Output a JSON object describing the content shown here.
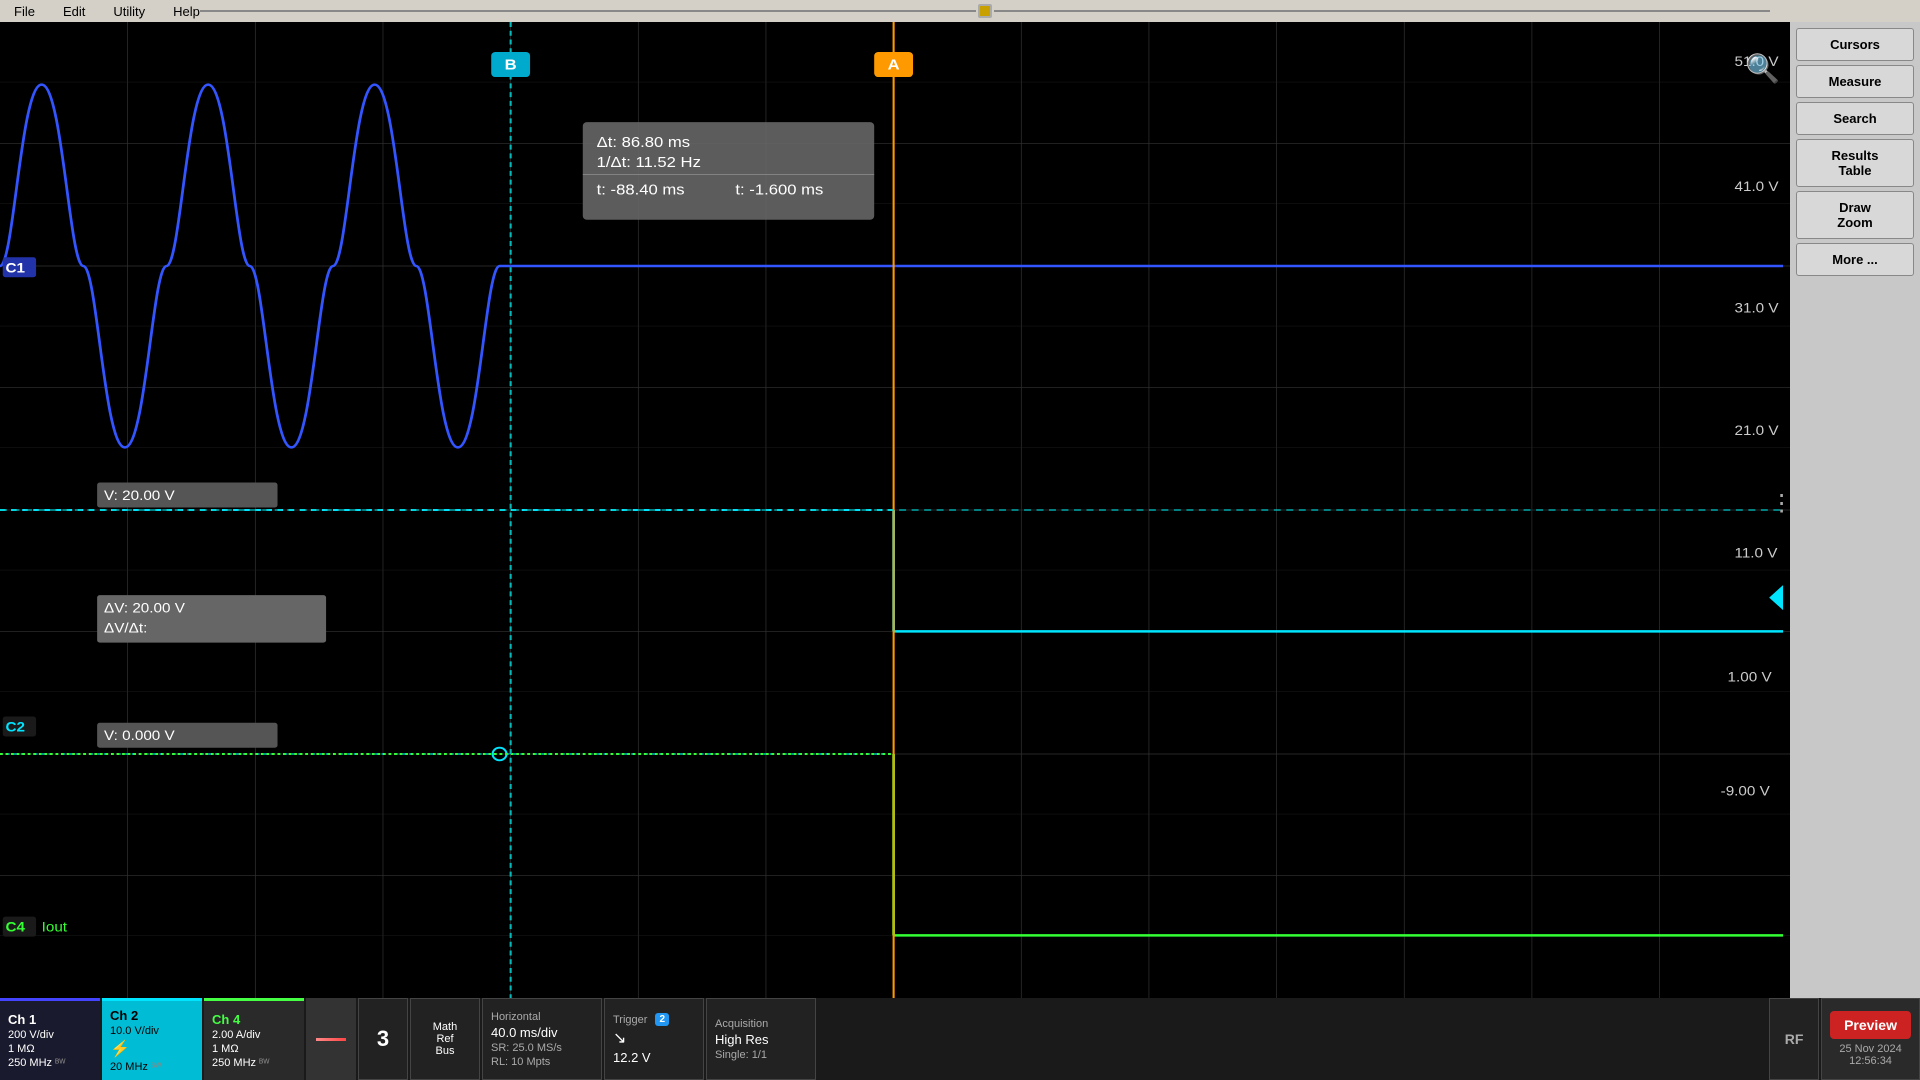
{
  "menubar": {
    "file": "File",
    "edit": "Edit",
    "utility": "Utility",
    "help": "Help"
  },
  "right_panel": {
    "cursors_label": "Cursors",
    "measure_label": "Measure",
    "search_label": "Search",
    "results_table_label": "Results\nTable",
    "draw_zoom_label": "Draw\nZoom",
    "more_label": "More ..."
  },
  "scope": {
    "v_labels": [
      {
        "value": "51.0 V",
        "pct": 4
      },
      {
        "value": "41.0 V",
        "pct": 18
      },
      {
        "value": "31.0 V",
        "pct": 33
      },
      {
        "value": "21.0 V",
        "pct": 47
      },
      {
        "value": "11.0 V",
        "pct": 62
      },
      {
        "value": "1.00 V",
        "pct": 76
      },
      {
        "value": "-9.00 V",
        "pct": 88
      }
    ],
    "cursor_box": {
      "delta_t": "Δt:   86.80 ms",
      "inv_delta_t": "1/Δt:  11.52 Hz",
      "t_a": "t:   -88.40 ms",
      "t_b": "t:    -1.600 ms"
    },
    "cursor_a_label": "A",
    "cursor_b_label": "B",
    "ch1_label": "C1",
    "ch2_label": "C2",
    "ch4_label": "C4",
    "ch4_name": "Iout",
    "v_readout_ch1": "V:  20.00 V",
    "v_readout_ch2": "V:  0.000 V",
    "delta_v": "ΔV:     20.00 V",
    "delta_v_dt": "ΔV/Δt:"
  },
  "status_bar": {
    "ch1": {
      "label": "Ch 1",
      "vdiv": "200 V/div",
      "impedance": "1 MΩ",
      "bandwidth": "250 MHz"
    },
    "ch2": {
      "label": "Ch 2",
      "vdiv": "10.0 V/div",
      "coupling": "",
      "bandwidth": "20 MHz"
    },
    "ch4": {
      "label": "Ch 4",
      "adiv": "2.00 A/div",
      "impedance": "1 MΩ",
      "bandwidth": "250 MHz"
    },
    "num": "3",
    "math_ref_bus": "Math\nRef\nBus",
    "horizontal": {
      "title": "Horizontal",
      "msdiv": "40.0 ms/div",
      "sr": "SR: 25.0 MS/s",
      "rl": "RL: 10 Mpts"
    },
    "trigger": {
      "title": "Trigger",
      "badge": "2",
      "slope": "↘",
      "voltage": "12.2 V"
    },
    "acquisition": {
      "title": "Acquisition",
      "mode": "High Res",
      "single": "Single: 1/1"
    },
    "rf_label": "RF",
    "preview_label": "Preview",
    "date": "25 Nov 2024",
    "time": "12:56:34"
  }
}
